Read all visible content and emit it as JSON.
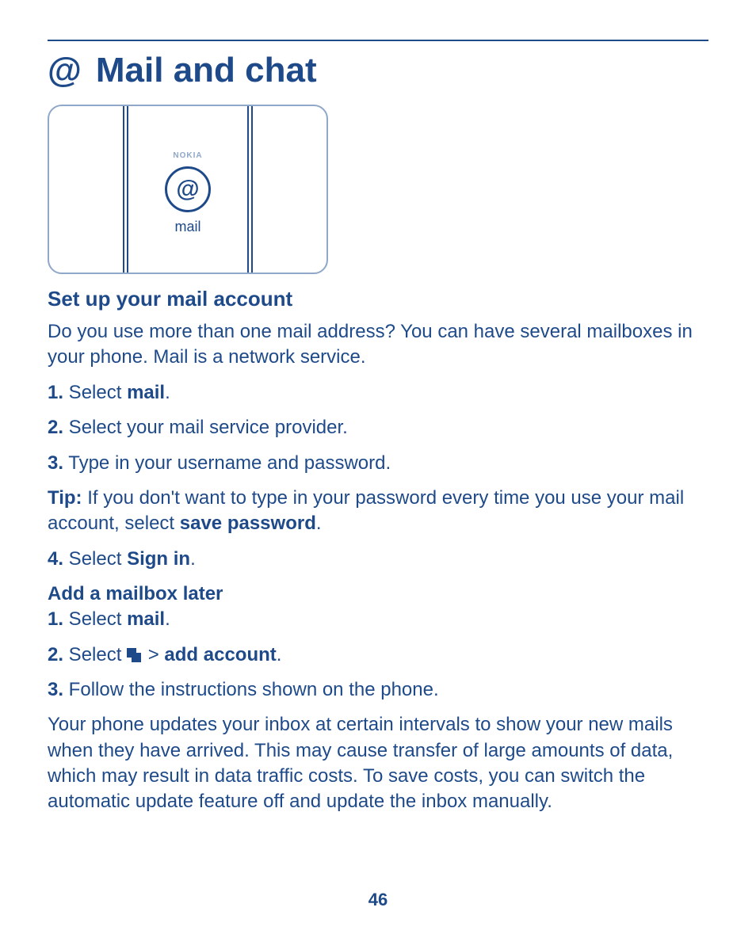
{
  "chapter": {
    "icon": "@",
    "title": "Mail and chat"
  },
  "screenshot": {
    "brand": "NOKIA",
    "icon": "@",
    "label": "mail"
  },
  "section1": {
    "heading": "Set up your mail account",
    "intro": "Do you use more than one mail address? You can have several mailboxes in your phone. Mail is a network service.",
    "steps": {
      "s1_num": "1.",
      "s1_a": " Select ",
      "s1_b": "mail",
      "s1_c": ".",
      "s2_num": "2.",
      "s2": " Select your mail service provider.",
      "s3_num": "3.",
      "s3": " Type in your username and password."
    },
    "tip_label": "Tip:",
    "tip_a": " If you don't want to type in your password every time you use your mail account, select ",
    "tip_b": "save password",
    "tip_c": ".",
    "step4_num": "4.",
    "step4_a": " Select ",
    "step4_b": "Sign in",
    "step4_c": "."
  },
  "section2": {
    "heading": "Add a mailbox later",
    "s1_num": "1.",
    "s1_a": " Select ",
    "s1_b": "mail",
    "s1_c": ".",
    "s2_num": "2.",
    "s2_a": " Select ",
    "s2_gt": " > ",
    "s2_b": "add account",
    "s2_c": ".",
    "s3_num": "3.",
    "s3": " Follow the instructions shown on the phone.",
    "outro": "Your phone updates your inbox at certain intervals to show your new mails when they have arrived. This may cause transfer of large amounts of data, which may result in data traffic costs. To save costs, you can switch the automatic update feature off and update the inbox manually."
  },
  "page_number": "46"
}
